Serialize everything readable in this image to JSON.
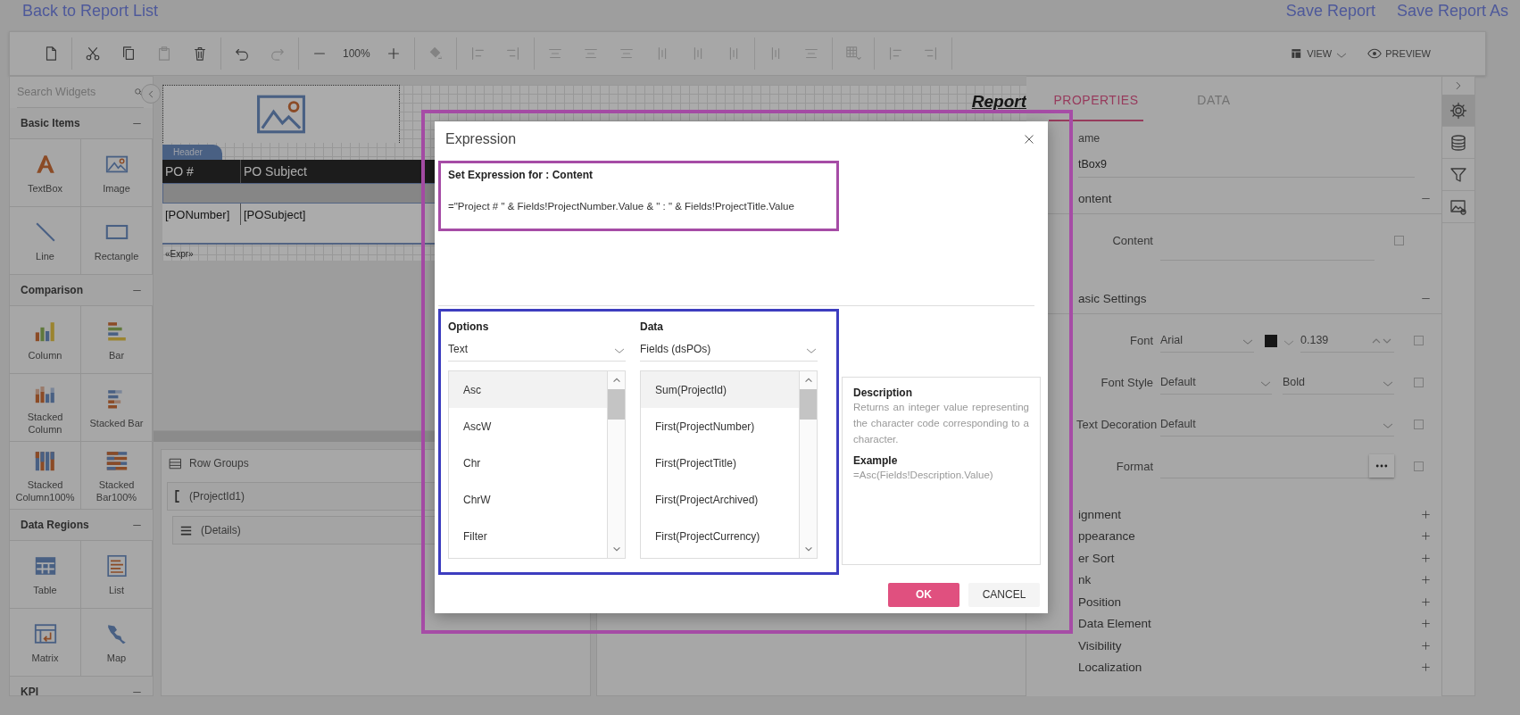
{
  "top_bar": {
    "back_link": "Back to Report List",
    "actions": [
      "Save Report",
      "Save Report As"
    ]
  },
  "toolbar": {
    "zoom": "100%",
    "view": "VIEW",
    "preview": "PREVIEW"
  },
  "widgets": {
    "search": {
      "placeholder": "Search Widgets"
    },
    "sections": [
      {
        "title": "Basic Items",
        "expanded": true,
        "items": [
          {
            "label": "TextBox",
            "kind": "textbox"
          },
          {
            "label": "Image",
            "kind": "image"
          },
          {
            "label": "Line",
            "kind": "line"
          },
          {
            "label": "Rectangle",
            "kind": "rectangle"
          }
        ]
      },
      {
        "title": "Comparison",
        "expanded": true,
        "items": [
          {
            "label": "Column",
            "kind": "column"
          },
          {
            "label": "Bar",
            "kind": "bar"
          },
          {
            "label": "Stacked Column",
            "kind": "stacked-column"
          },
          {
            "label": "Stacked Bar",
            "kind": "stacked-bar"
          },
          {
            "label": "Stacked Column100%",
            "kind": "stacked-column100"
          },
          {
            "label": "Stacked Bar100%",
            "kind": "stacked-bar100"
          }
        ]
      },
      {
        "title": "Data Regions",
        "expanded": true,
        "items": [
          {
            "label": "Table",
            "kind": "table"
          },
          {
            "label": "List",
            "kind": "list"
          },
          {
            "label": "Matrix",
            "kind": "matrix"
          },
          {
            "label": "Map",
            "kind": "map"
          }
        ]
      },
      {
        "title": "KPI",
        "expanded": true
      }
    ]
  },
  "design": {
    "report_title": "Report",
    "band_tab": "Header",
    "table": {
      "columns": [
        "PO #",
        "PO Subject"
      ],
      "rows": [
        [
          "[PONumber]",
          "[POSubject]"
        ]
      ]
    },
    "footer_text": "«Expr»"
  },
  "row_groups": {
    "title": "Row Groups",
    "items": [
      {
        "label": "(ProjectId1)",
        "kind": "group",
        "children": [
          {
            "label": "(Details)",
            "kind": "details"
          }
        ]
      }
    ]
  },
  "properties": {
    "tabs": [
      {
        "label": "PROPERTIES",
        "selected": true
      },
      {
        "label": "DATA",
        "selected": false
      }
    ],
    "name": {
      "label": "ame",
      "value": "tBox9"
    },
    "sections": [
      {
        "title": "ontent",
        "expanded": true,
        "rows": [
          {
            "kind": "text",
            "label": "Content",
            "checked": false
          }
        ]
      },
      {
        "title": "asic Settings",
        "expanded": true,
        "rows": [
          {
            "kind": "font",
            "label": "Font",
            "value": "Arial",
            "color": "#222222",
            "size": "0.139",
            "checked": false
          },
          {
            "kind": "pair",
            "label": "Font Style",
            "value": "Default",
            "value2": "Bold",
            "checked": false
          },
          {
            "kind": "select",
            "label": "Text Decoration",
            "value": "Default",
            "checked": false
          },
          {
            "kind": "format",
            "label": "Format",
            "checked": false
          }
        ]
      },
      {
        "title": "ignment",
        "expanded": false
      },
      {
        "title": "ppearance",
        "expanded": false
      },
      {
        "title": "er Sort",
        "expanded": false
      },
      {
        "title": "nk",
        "expanded": false
      },
      {
        "title": "Position",
        "expanded": false
      },
      {
        "title": "Data Element",
        "expanded": false
      },
      {
        "title": "Visibility",
        "expanded": false
      },
      {
        "title": "Localization",
        "expanded": false
      }
    ]
  },
  "dialog": {
    "title": "Expression",
    "expression_label": "Set Expression for : Content",
    "expression": "=\"Project # \" & Fields!ProjectNumber.Value & \" : \" & Fields!ProjectTitle.Value",
    "options": {
      "label": "Options",
      "value": "Text",
      "items": [
        {
          "label": "Asc",
          "selected": true
        },
        {
          "label": "AscW",
          "selected": false
        },
        {
          "label": "Chr",
          "selected": false
        },
        {
          "label": "ChrW",
          "selected": false
        },
        {
          "label": "Filter",
          "selected": false
        }
      ]
    },
    "data": {
      "label": "Data",
      "value": "Fields (dsPOs)",
      "items": [
        {
          "label": "Sum(ProjectId)",
          "selected": true
        },
        {
          "label": "First(ProjectNumber)",
          "selected": false
        },
        {
          "label": "First(ProjectTitle)",
          "selected": false
        },
        {
          "label": "First(ProjectArchived)",
          "selected": false
        },
        {
          "label": "First(ProjectCurrency)",
          "selected": false
        }
      ]
    },
    "description": {
      "heading": "Description",
      "text": "Returns an integer value representing the character code corresponding to a character.",
      "example_heading": "Example",
      "example": "=Asc(Fields!Description.Value)"
    },
    "buttons": [
      {
        "label": "OK",
        "kind": "primary"
      },
      {
        "label": "CANCEL",
        "kind": "secondary"
      }
    ]
  },
  "highlights": [
    {
      "color": "#a64ca6"
    },
    {
      "color": "#a64ca6"
    },
    {
      "color": "#3d3dbf"
    }
  ]
}
